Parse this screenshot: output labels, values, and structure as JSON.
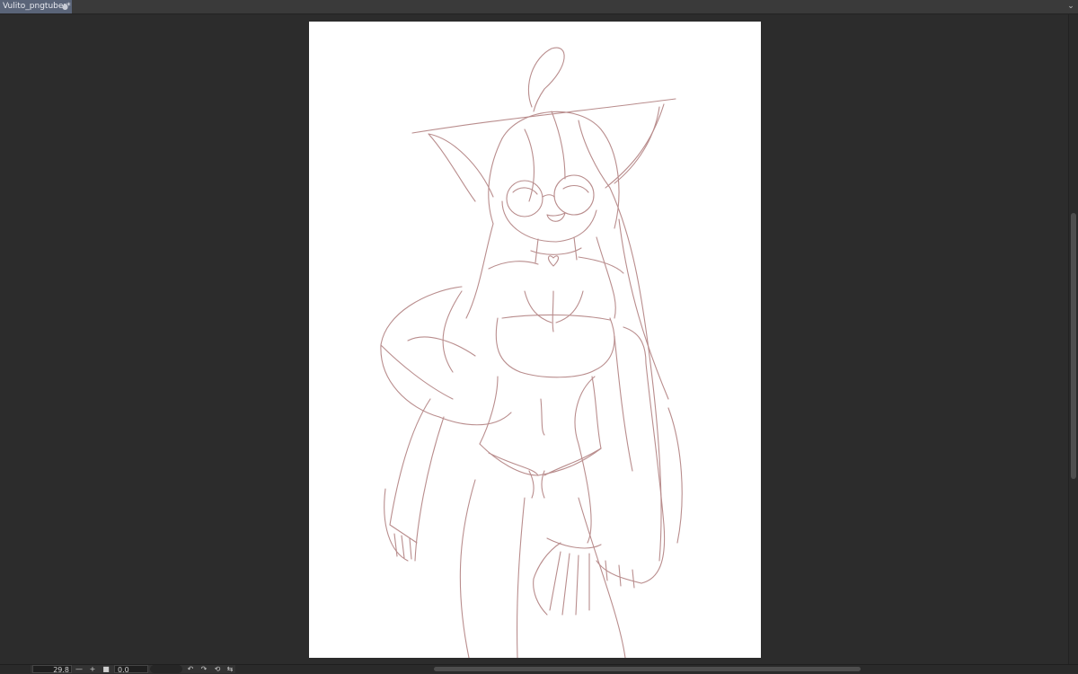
{
  "document_tab": {
    "title": "Vulito_pngtuber*",
    "close_glyph": "●"
  },
  "tabbar": {
    "menu_glyph": "⌄"
  },
  "canvas": {
    "stroke_color": "#b98d8d",
    "background": "#ffffff"
  },
  "statusbar": {
    "zoom_value": "29.8",
    "zoom_out_glyph": "—",
    "zoom_in_glyph": "+",
    "stop_glyph": "■",
    "rotation_value": "0.0",
    "rotate_left_glyph": "↶",
    "rotate_right_glyph": "↷",
    "reset_glyph": "⟲",
    "flip_glyph": "⇆"
  }
}
